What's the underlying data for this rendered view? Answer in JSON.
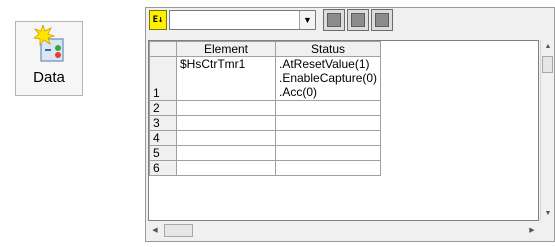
{
  "data_button": {
    "label": "Data",
    "icon": "data-burst-icon"
  },
  "toolbar": {
    "sort_label": "E↓",
    "combo_value": "",
    "combo_arrow": "▼",
    "buttons": [
      "grid-button-1",
      "grid-button-2",
      "grid-button-3"
    ]
  },
  "grid": {
    "columns": [
      "Element",
      "Status"
    ],
    "rows": [
      {
        "num": "1",
        "element": "$HsCtrTmr1",
        "status": [
          ".AtResetValue(1)",
          ".EnableCapture(0)",
          ".Acc(0)"
        ]
      },
      {
        "num": "2",
        "element": "",
        "status": []
      },
      {
        "num": "3",
        "element": "",
        "status": []
      },
      {
        "num": "4",
        "element": "",
        "status": []
      },
      {
        "num": "5",
        "element": "",
        "status": []
      },
      {
        "num": "6",
        "element": "",
        "status": []
      }
    ]
  },
  "scroll": {
    "up": "▲",
    "down": "▼",
    "left": "◀",
    "right": "▶"
  }
}
